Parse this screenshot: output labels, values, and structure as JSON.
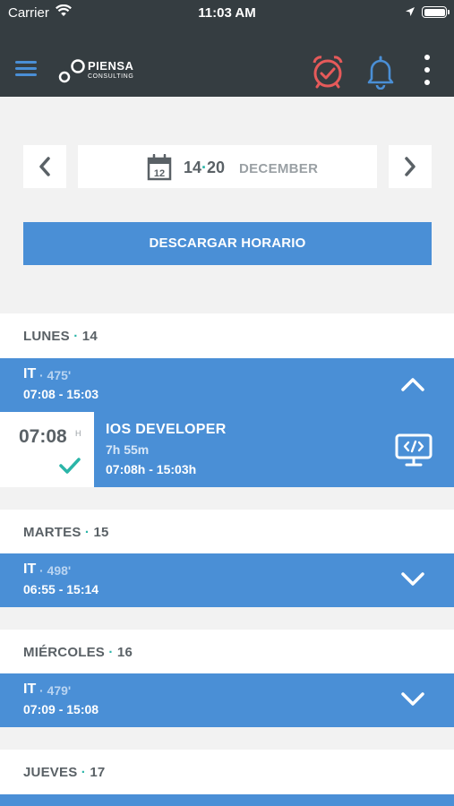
{
  "status_bar": {
    "carrier": "Carrier",
    "time": "11:03 AM"
  },
  "app": {
    "logo_name": "PIENSA",
    "logo_sub": "CONSULTING"
  },
  "week": {
    "range_start": "14",
    "range_sep": "·",
    "range_end": "20",
    "month": "DECEMBER",
    "calendar_day": "12"
  },
  "download_button": "DESCARGAR HORARIO",
  "colors": {
    "header": "#353d41",
    "accent_blue": "#4a8fd6",
    "teal": "#2bb5a8",
    "alarm_red": "#e65a5a"
  },
  "days": [
    {
      "name": "LUNES",
      "sep": " · ",
      "num": "14",
      "shift": {
        "code": "IT",
        "minutes": "· 475'",
        "range": "07:08 - 15:03",
        "expanded": true
      }
    },
    {
      "name": "MARTES",
      "sep": " · ",
      "num": "15",
      "shift": {
        "code": "IT",
        "minutes": "· 498'",
        "range": "06:55 - 15:14",
        "expanded": false
      }
    },
    {
      "name": "MIÉRCOLES",
      "sep": " · ",
      "num": "16",
      "shift": {
        "code": "IT",
        "minutes": "· 479'",
        "range": "07:09 - 15:08",
        "expanded": false
      }
    },
    {
      "name": "JUEVES",
      "sep": " · ",
      "num": "17"
    }
  ],
  "detail": {
    "time": "07:08",
    "unit": "H",
    "title": "IOS DEVELOPER",
    "duration": "7h 55m",
    "hours": "07:08h - 15:03h"
  }
}
